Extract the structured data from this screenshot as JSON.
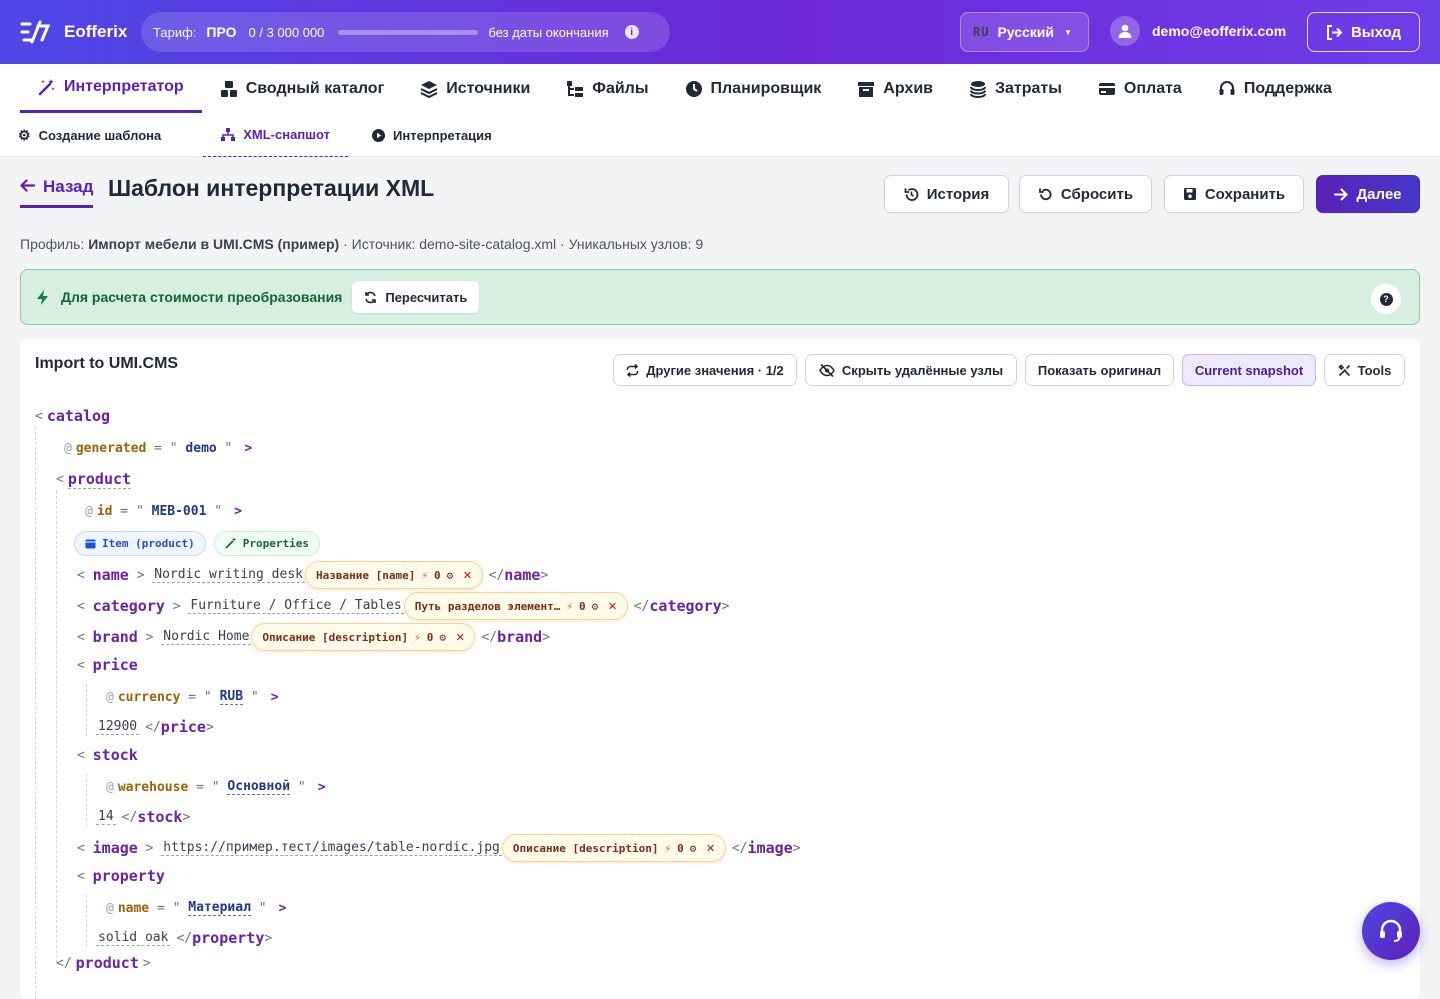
{
  "app": {
    "name": "Eofferix"
  },
  "tariff": {
    "label": "Тариф:",
    "plan": "ПРО",
    "usage": "0  /  3 000 000",
    "usage_fraction": 0,
    "expiry": "без даты окончания"
  },
  "lang": {
    "code": "RU",
    "name": "Русский"
  },
  "user": {
    "email": "demo@eofferix.com"
  },
  "logout_label": "Выход",
  "nav": [
    {
      "label": "Интерпретатор",
      "icon": "magic-wand-icon",
      "active": true
    },
    {
      "label": "Сводный каталог",
      "icon": "boxes-icon"
    },
    {
      "label": "Источники",
      "icon": "layers-icon"
    },
    {
      "label": "Файлы",
      "icon": "folder-tree-icon"
    },
    {
      "label": "Планировщик",
      "icon": "clock-icon"
    },
    {
      "label": "Архив",
      "icon": "archive-icon"
    },
    {
      "label": "Затраты",
      "icon": "coins-icon"
    },
    {
      "label": "Оплата",
      "icon": "credit-card-icon"
    },
    {
      "label": "Поддержка",
      "icon": "headset-icon"
    }
  ],
  "subnav": [
    {
      "label": "Создание шаблона",
      "icon": "gear-icon"
    },
    {
      "label": "XML-снапшот",
      "icon": "sitemap-icon",
      "active": true
    },
    {
      "label": "Интерпретация",
      "icon": "play-icon"
    }
  ],
  "page": {
    "back_label": "Назад",
    "title": "Шаблон интерпретации XML",
    "buttons": {
      "history": "История",
      "reset": "Сбросить",
      "save": "Сохранить",
      "next": "Далее"
    },
    "meta": {
      "profile_label": "Профиль:",
      "profile": "Импорт мебели в UMI.CMS (пример)",
      "rest": " · Источник: demo-site-catalog.xml · Уникальных узлов: 9"
    }
  },
  "notice": {
    "text": "Для расчета стоимости преобразования",
    "button": "Пересчитать"
  },
  "panel": {
    "title": "Import to UMI.CMS",
    "toolbar": {
      "other_values": "Другие значения · 1/2",
      "hide_deleted": "Скрыть удалённые узлы",
      "show_original": "Показать оригинал",
      "current_snapshot": "Current snapshot",
      "tools": "Tools"
    }
  },
  "xml": {
    "root": "catalog",
    "root_attr": {
      "name": "generated",
      "value": "demo"
    },
    "product": "product",
    "product_attr": {
      "name": "id",
      "value": "MEB-001"
    },
    "badge_item": "Item (product)",
    "badge_props": "Properties",
    "name": {
      "tag": "name",
      "value": "Nordic writing desk",
      "chip": "Название [name]",
      "count": "0"
    },
    "category": {
      "tag": "category",
      "value": "Furniture / Office / Tables",
      "chip": "Путь разделов элемент…",
      "count": "0"
    },
    "brand": {
      "tag": "brand",
      "value": "Nordic Home",
      "chip": "Описание [description]",
      "count": "0"
    },
    "price": {
      "tag": "price",
      "attr_name": "currency",
      "attr_value": "RUB",
      "value": "12900"
    },
    "stock": {
      "tag": "stock",
      "attr_name": "warehouse",
      "attr_value": "Основной",
      "value": "14"
    },
    "image": {
      "tag": "image",
      "value": "https://пример.тест/images/table-nordic.jpg",
      "chip": "Описание [description]",
      "count": "0"
    },
    "property": {
      "tag": "property",
      "attr_name": "name",
      "attr_value": "Материал",
      "value": "solid oak"
    }
  }
}
